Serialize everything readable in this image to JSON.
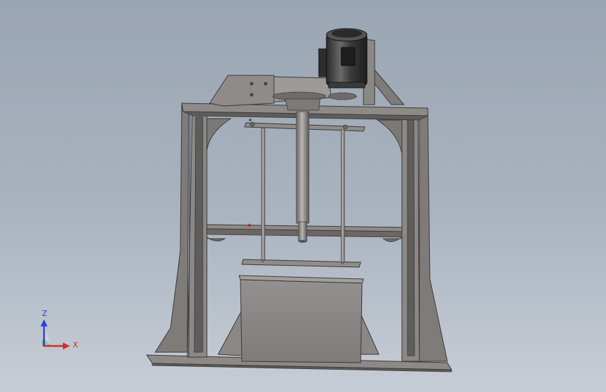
{
  "viewport": {
    "background_top": "#9aa5b3",
    "background_bottom": "#c7cdd6"
  },
  "model": {
    "description_items": [
      "frame",
      "motor",
      "gearbox",
      "spindle",
      "guide-rods",
      "container"
    ],
    "colors": {
      "steel": "#7b7876",
      "steel_dark": "#4a4847",
      "steel_light": "#a09c98",
      "motor": "#3b3b3b",
      "container": "#8a8785"
    }
  },
  "triad": {
    "z_label": "Z",
    "x_label": "X",
    "z_color": "#2e3fd6",
    "x_color": "#d62a2a",
    "y_color": "#1f9e3a"
  }
}
